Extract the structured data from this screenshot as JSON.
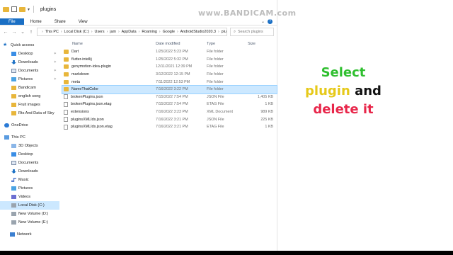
{
  "window": {
    "title": "plugins"
  },
  "watermark": "www.BANDICAM.com",
  "ribbon": {
    "tabs": [
      "File",
      "Home",
      "Share",
      "View"
    ]
  },
  "address": {
    "crumbs": [
      "This PC",
      "Local Disk (C:)",
      "Users",
      "jam",
      "AppData",
      "Roaming",
      "Google",
      "AndroidStudio2020.3",
      "plugins"
    ],
    "search_placeholder": "Search plugins"
  },
  "nav": {
    "items": [
      {
        "label": "Quick access",
        "icon": "star-icon"
      },
      {
        "label": "Desktop",
        "icon": "desktop-icon"
      },
      {
        "label": "Downloads",
        "icon": "download-icon"
      },
      {
        "label": "Documents",
        "icon": "documents-icon"
      },
      {
        "label": "Pictures",
        "icon": "pictures-icon"
      },
      {
        "label": "Bandicam",
        "icon": "folder-icon"
      },
      {
        "label": "english song",
        "icon": "folder-icon"
      },
      {
        "label": "Fruit images",
        "icon": "folder-icon"
      },
      {
        "label": "Rts And Data of Stry",
        "icon": "folder-icon"
      },
      {
        "label": "OneDrive",
        "icon": "cloud-icon"
      },
      {
        "label": "This PC",
        "icon": "computer-icon"
      },
      {
        "label": "3D Objects",
        "icon": "cube-icon"
      },
      {
        "label": "Desktop",
        "icon": "desktop-icon"
      },
      {
        "label": "Documents",
        "icon": "documents-icon"
      },
      {
        "label": "Downloads",
        "icon": "download-icon"
      },
      {
        "label": "Music",
        "icon": "music-icon"
      },
      {
        "label": "Pictures",
        "icon": "pictures-icon"
      },
      {
        "label": "Videos",
        "icon": "video-icon"
      },
      {
        "label": "Local Disk (C:)",
        "icon": "disk-icon"
      },
      {
        "label": "New Volume (D:)",
        "icon": "disk-icon"
      },
      {
        "label": "New Volume (E:)",
        "icon": "disk-icon"
      },
      {
        "label": "Network",
        "icon": "network-icon"
      }
    ]
  },
  "list": {
    "headers": {
      "name": "Name",
      "date": "Date modified",
      "type": "Type",
      "size": "Size"
    },
    "rows": [
      {
        "name": "Dart",
        "date": "1/25/2022 5:23 PM",
        "type": "File folder",
        "size": "",
        "kind": "folder"
      },
      {
        "name": "flutter-intellij",
        "date": "1/25/2022 5:32 PM",
        "type": "File folder",
        "size": "",
        "kind": "folder"
      },
      {
        "name": "genymotion-idea-plugin",
        "date": "12/11/2021 12:39 PM",
        "type": "File folder",
        "size": "",
        "kind": "folder"
      },
      {
        "name": "markdown",
        "date": "3/12/2022 12:15 PM",
        "type": "File folder",
        "size": "",
        "kind": "folder"
      },
      {
        "name": "meta",
        "date": "7/11/2022 12:53 PM",
        "type": "File folder",
        "size": "",
        "kind": "folder"
      },
      {
        "name": "NameThatColor",
        "date": "7/16/2022 3:22 PM",
        "type": "File folder",
        "size": "",
        "kind": "folder",
        "selected": true
      },
      {
        "name": "brokenPlugins.json",
        "date": "7/15/2022 7:54 PM",
        "type": "JSON File",
        "size": "1,405 KB",
        "kind": "file"
      },
      {
        "name": "brokenPlugins.json.etag",
        "date": "7/15/2022 7:54 PM",
        "type": "ETAG File",
        "size": "1 KB",
        "kind": "file"
      },
      {
        "name": "extensions",
        "date": "7/16/2022 3:23 PM",
        "type": "XML Document",
        "size": "989 KB",
        "kind": "file"
      },
      {
        "name": "pluginsXMLIds.json",
        "date": "7/16/2022 3:21 PM",
        "type": "JSON File",
        "size": "225 KB",
        "kind": "file"
      },
      {
        "name": "pluginsXMLIds.json.etag",
        "date": "7/16/2022 3:21 PM",
        "type": "ETAG File",
        "size": "1 KB",
        "kind": "file"
      }
    ]
  },
  "overlay": {
    "line1": "Select",
    "line2a": "plugin",
    "line2b": "and",
    "line3": "delete it"
  }
}
